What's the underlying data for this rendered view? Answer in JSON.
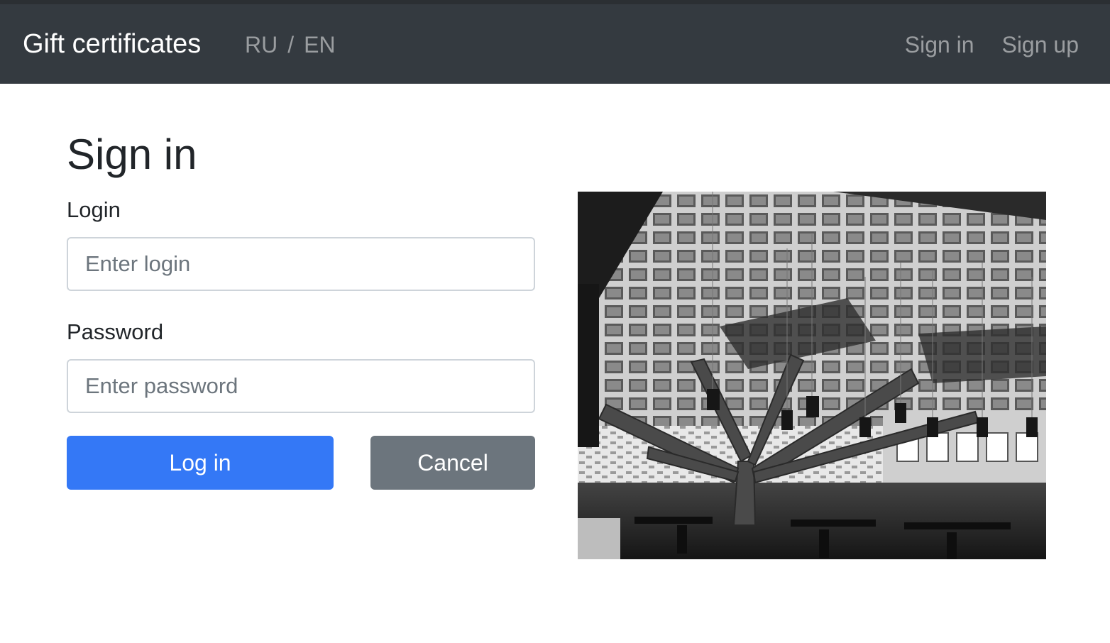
{
  "navbar": {
    "brand": "Gift certificates",
    "languages": [
      "RU",
      "EN"
    ],
    "separator": "/",
    "links": [
      "Sign in",
      "Sign up"
    ]
  },
  "form": {
    "title": "Sign in",
    "login_label": "Login",
    "login_placeholder": "Enter login",
    "password_label": "Password",
    "password_placeholder": "Enter password",
    "submit_label": "Log in",
    "cancel_label": "Cancel"
  },
  "colors": {
    "navbar_bg": "#343a40",
    "primary": "#3478f6",
    "secondary": "#6c757d"
  },
  "image": {
    "subject": "black-and-white photo of a library hall with coffered concrete ceiling and branching tree-like column"
  }
}
